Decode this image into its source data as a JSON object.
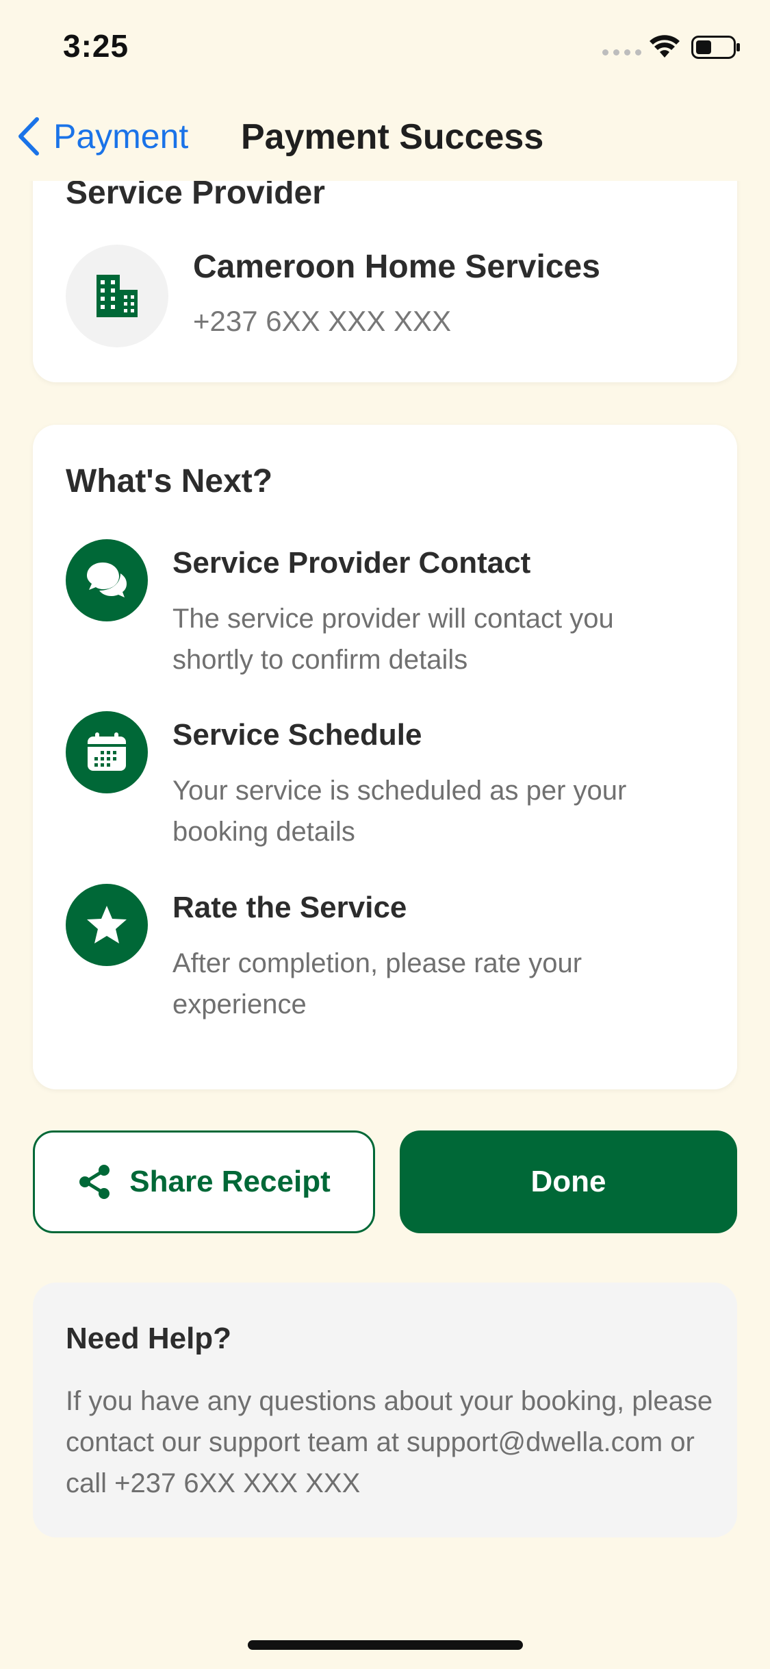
{
  "status_bar": {
    "time": "3:25"
  },
  "nav": {
    "back_label": "Payment",
    "title": "Payment Success"
  },
  "provider_card": {
    "title": "Service Provider",
    "name": "Cameroon Home Services",
    "phone": "+237 6XX XXX XXX",
    "icon": "building-icon"
  },
  "next_card": {
    "title": "What's Next?",
    "steps": [
      {
        "icon": "chat-icon",
        "title": "Service Provider Contact",
        "desc": "The service provider will contact you shortly to confirm details"
      },
      {
        "icon": "calendar-icon",
        "title": "Service Schedule",
        "desc": "Your service is scheduled as per your booking details"
      },
      {
        "icon": "star-icon",
        "title": "Rate the Service",
        "desc": "After completion, please rate your experience"
      }
    ]
  },
  "actions": {
    "share_label": "Share Receipt",
    "done_label": "Done"
  },
  "help": {
    "title": "Need Help?",
    "text": "If you have any questions about your booking, please contact our support team at support@dwella.com or call +237 6XX XXX XXX"
  },
  "colors": {
    "brand_green": "#006837",
    "link_blue": "#1a73e8",
    "background": "#fdf8e8"
  }
}
